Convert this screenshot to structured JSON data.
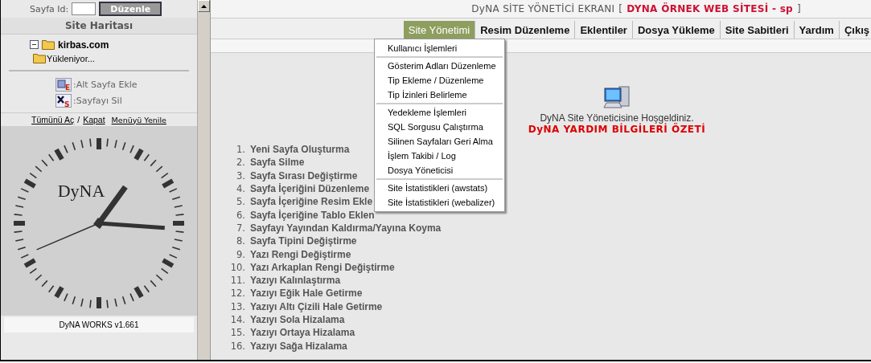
{
  "sidebar": {
    "page_id_label": "Sayfa Id:",
    "edit_button": "Düzenle",
    "title": "Site Haritası",
    "tree": [
      {
        "label": "kirbas.com",
        "expanded": true,
        "children": [
          {
            "label": "Yükleniyor..."
          }
        ]
      }
    ],
    "legend": [
      {
        "kind": "add",
        "icon_letter": "E",
        "text": ":Alt Sayfa Ekle"
      },
      {
        "kind": "delete",
        "icon_letter": "S",
        "text": ":Sayfayı Sil"
      }
    ],
    "links": [
      "Tümünü Aç",
      "/",
      "Kapat",
      "Menüyü Yenile"
    ],
    "clock": {
      "brand": "DyNA"
    },
    "version": "DyNA WORKS v1.661"
  },
  "header": {
    "title": "DyNA SİTE YÖNETİCİ EKRANI",
    "open_bracket": "[",
    "site": "DYNA ÖRNEK WEB SİTESİ - sp",
    "close_bracket": "]"
  },
  "tabs": [
    {
      "label": "Site Yönetimi",
      "selected": true
    },
    {
      "label": "Resim Düzenleme",
      "selected": false
    },
    {
      "label": "Eklentiler",
      "selected": false
    },
    {
      "label": "Dosya Yükleme",
      "selected": false
    },
    {
      "label": "Site Sabitleri",
      "selected": false
    },
    {
      "label": "Yardım",
      "selected": false
    },
    {
      "label": "Çıkış",
      "selected": false
    }
  ],
  "menu": {
    "groups": [
      [
        "Kullanıcı İşlemleri"
      ],
      [
        "Gösterim Adları Düzenleme",
        "Tip Ekleme / Düzenleme",
        "Tip İzinleri Belirleme"
      ],
      [
        "Yedekleme İşlemleri",
        "SQL  Sorgusu Çalıştırma",
        "Silinen Sayfaları Geri Alma",
        "İşlem Takibi / Log",
        "Dosya Yöneticisi"
      ],
      [
        "Site İstatistikleri (awstats)",
        "Site İstatistikleri (webalizer)"
      ]
    ]
  },
  "welcome": {
    "text": "DyNA Site Yöneticisine Hoşgeldiniz.",
    "heading": "DyNA YARDIM BİLGİLERİ ÖZETİ"
  },
  "help_list": [
    {
      "number": "1.",
      "text": "Yeni Sayfa Oluşturma"
    },
    {
      "number": "2.",
      "text": "Sayfa Silme"
    },
    {
      "number": "3.",
      "text": "Sayfa Sırası Değiştirme"
    },
    {
      "number": "4.",
      "text": "Sayfa İçeriğini Düzenleme"
    },
    {
      "number": "5.",
      "text": "Sayfa İçeriğine Resim Ekle"
    },
    {
      "number": "6.",
      "text": "Sayfa İçeriğine Tablo Eklen"
    },
    {
      "number": "7.",
      "text": "Sayfayı Yayından Kaldırma/Yayına Koyma"
    },
    {
      "number": "8.",
      "text": "Sayfa Tipini Değiştirme"
    },
    {
      "number": "9.",
      "text": "Yazı Rengi Değiştirme"
    },
    {
      "number": "10.",
      "text": "Yazı Arkaplan Rengi Değiştirme"
    },
    {
      "number": "11.",
      "text": "Yazıyı Kalınlaştırma"
    },
    {
      "number": "12.",
      "text": "Yazıyı Eğik Hale Getirme"
    },
    {
      "number": "13.",
      "text": "Yazıyı Altı Çizili Hale Getirme"
    },
    {
      "number": "14.",
      "text": "Yazıyı Sola Hizalama"
    },
    {
      "number": "15.",
      "text": "Yazıyı Ortaya Hizalama"
    },
    {
      "number": "16.",
      "text": "Yazıyı Sağa Hizalama"
    }
  ]
}
